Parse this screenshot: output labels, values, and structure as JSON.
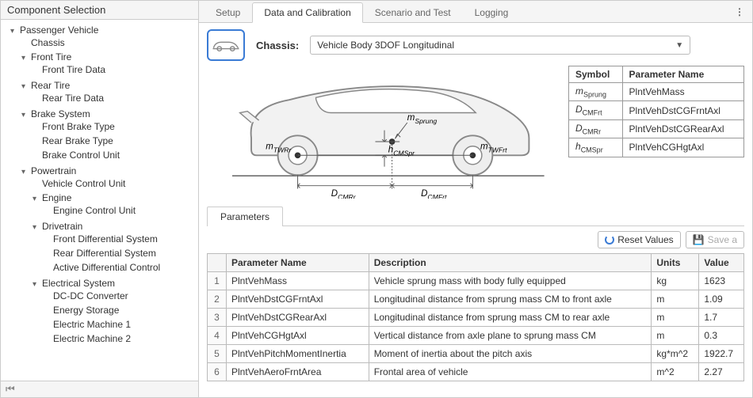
{
  "sidebar": {
    "title": "Component Selection",
    "tree": {
      "root": "Passenger Vehicle",
      "chassis": "Chassis",
      "front_tire": "Front Tire",
      "front_tire_data": "Front Tire Data",
      "rear_tire": "Rear Tire",
      "rear_tire_data": "Rear Tire Data",
      "brake_system": "Brake System",
      "front_brake_type": "Front Brake Type",
      "rear_brake_type": "Rear Brake Type",
      "brake_control_unit": "Brake Control Unit",
      "powertrain": "Powertrain",
      "vehicle_control_unit": "Vehicle Control Unit",
      "engine": "Engine",
      "engine_control_unit": "Engine Control Unit",
      "drivetrain": "Drivetrain",
      "front_diff": "Front Differential System",
      "rear_diff": "Rear Differential System",
      "active_diff": "Active Differential Control",
      "electrical_system": "Electrical System",
      "dcdc": "DC-DC Converter",
      "energy_storage": "Energy Storage",
      "em1": "Electric Machine 1",
      "em2": "Electric Machine 2"
    }
  },
  "tabs": {
    "setup": "Setup",
    "data_calibration": "Data and Calibration",
    "scenario_test": "Scenario and Test",
    "logging": "Logging"
  },
  "chassis": {
    "label": "Chassis:",
    "selected": "Vehicle Body 3DOF Longitudinal"
  },
  "diagram_labels": {
    "mSprung": "m",
    "mSprung_sub": "Sprung",
    "mTWRr": "m",
    "mTWRr_sub": "TWRr",
    "mTWFrt": "m",
    "mTWFrt_sub": "TWFrt",
    "hCMSpr": "h",
    "hCMSpr_sub": "CMSpr",
    "DCMRr": "D",
    "DCMRr_sub": "CMRr",
    "DCMFrt": "D",
    "DCMFrt_sub": "CMFrt"
  },
  "legend": {
    "header_symbol": "Symbol",
    "header_param": "Parameter Name",
    "rows": [
      {
        "sym_base": "m",
        "sym_sub": "Sprung",
        "param": "PlntVehMass"
      },
      {
        "sym_base": "D",
        "sym_sub": "CMFrt",
        "param": "PlntVehDstCGFrntAxl"
      },
      {
        "sym_base": "D",
        "sym_sub": "CMRr",
        "param": "PlntVehDstCGRearAxl"
      },
      {
        "sym_base": "h",
        "sym_sub": "CMSpr",
        "param": "PlntVehCGHgtAxl"
      }
    ]
  },
  "parameters": {
    "tab_label": "Parameters",
    "reset_label": "Reset Values",
    "save_label": "Save a",
    "headers": {
      "name": "Parameter Name",
      "desc": "Description",
      "units": "Units",
      "value": "Value"
    },
    "rows": [
      {
        "n": "1",
        "name": "PlntVehMass",
        "desc": "Vehicle sprung mass with body fully equipped",
        "units": "kg",
        "value": "1623"
      },
      {
        "n": "2",
        "name": "PlntVehDstCGFrntAxl",
        "desc": "Longitudinal distance from sprung mass CM to front axle",
        "units": "m",
        "value": "1.09"
      },
      {
        "n": "3",
        "name": "PlntVehDstCGRearAxl",
        "desc": "Longitudinal distance from sprung mass CM to rear axle",
        "units": "m",
        "value": "1.7"
      },
      {
        "n": "4",
        "name": "PlntVehCGHgtAxl",
        "desc": "Vertical distance from axle plane to sprung mass CM",
        "units": "m",
        "value": "0.3"
      },
      {
        "n": "5",
        "name": "PlntVehPitchMomentInertia",
        "desc": "Moment of inertia about the pitch axis",
        "units": "kg*m^2",
        "value": "1922.7"
      },
      {
        "n": "6",
        "name": "PlntVehAeroFrntArea",
        "desc": "Frontal area of vehicle",
        "units": "m^2",
        "value": "2.27"
      }
    ]
  }
}
